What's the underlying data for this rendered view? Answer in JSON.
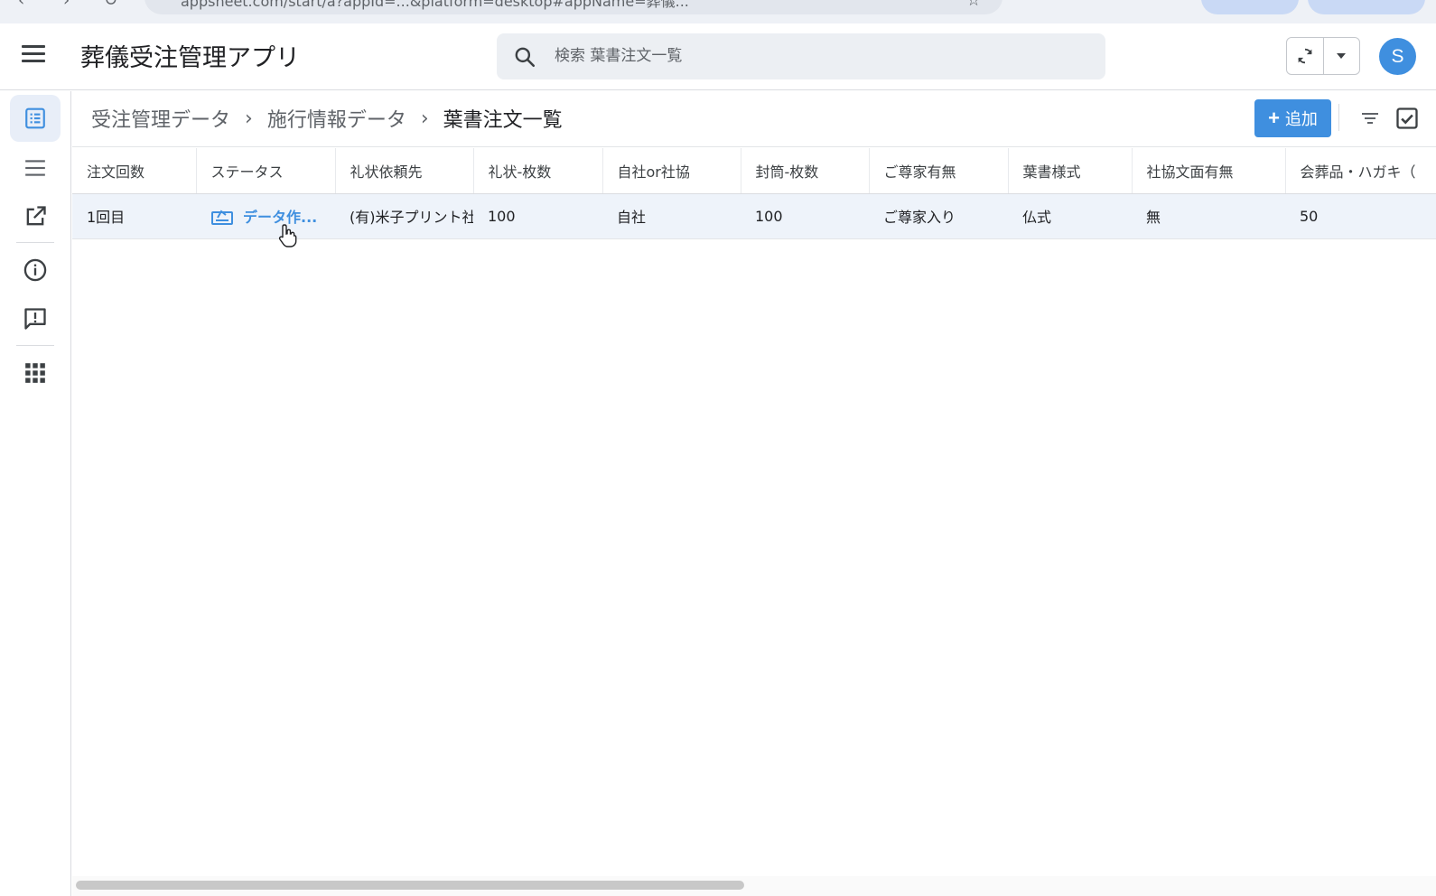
{
  "browser": {
    "url": "appsheet.com/start/a?appId=...&platform=desktop#appName=葬儀..."
  },
  "header": {
    "app_title": "葬儀受注管理アプリ",
    "search_placeholder": "検索 葉書注文一覧",
    "avatar_initial": "S"
  },
  "rail": {
    "items": [
      "list-view",
      "menu",
      "open-external",
      "info",
      "feedback",
      "apps"
    ]
  },
  "breadcrumb": [
    "受注管理データ",
    "施行情報データ",
    "葉書注文一覧"
  ],
  "toolbar": {
    "add_label": "追加"
  },
  "table": {
    "columns": [
      "注文回数",
      "ステータス",
      "礼状依頼先",
      "礼状-枚数",
      "自社or社協",
      "封筒-枚数",
      "ご尊家有無",
      "葉書様式",
      "社協文面有無",
      "会葬品・ハガキ（"
    ],
    "rows": [
      {
        "order_count": "1回目",
        "status": "データ作...",
        "recipient": "(有)米子プリント社",
        "letter_qty": "100",
        "company": "自社",
        "envelope_qty": "100",
        "family": "ご尊家入り",
        "style": "仏式",
        "text_flag": "無",
        "gift_qty": "50"
      }
    ]
  },
  "colors": {
    "accent": "#3f8fdf",
    "selected_row": "#eef3fa"
  }
}
